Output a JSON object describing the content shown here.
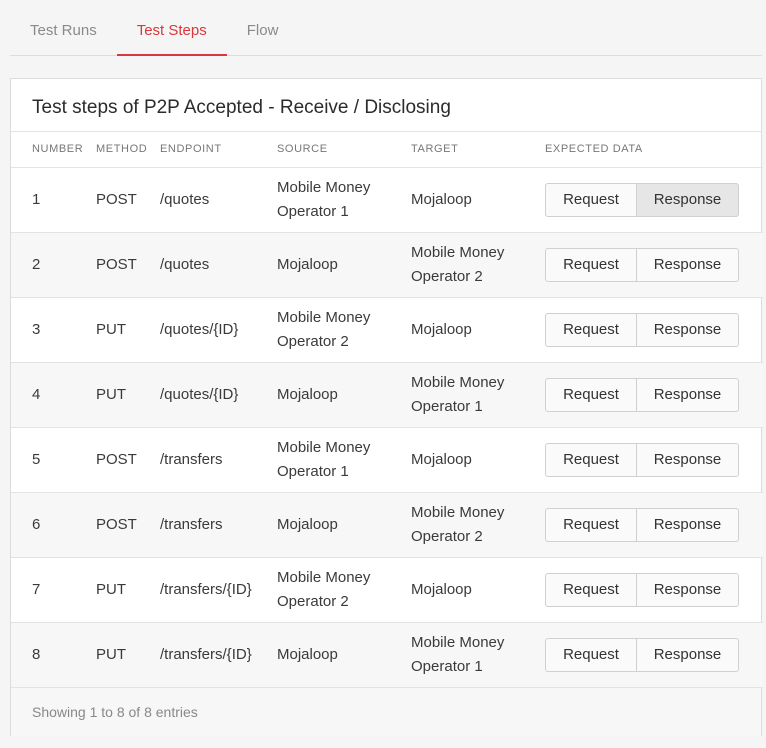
{
  "tabs": [
    {
      "label": "Test Runs",
      "active": false
    },
    {
      "label": "Test Steps",
      "active": true
    },
    {
      "label": "Flow",
      "active": false
    }
  ],
  "card": {
    "title": "Test steps of P2P Accepted - Receive / Disclosing"
  },
  "table": {
    "headers": [
      "NUMBER",
      "METHOD",
      "ENDPOINT",
      "SOURCE",
      "TARGET",
      "EXPECTED DATA"
    ],
    "request_label": "Request",
    "response_label": "Response",
    "rows": [
      {
        "number": "1",
        "method": "POST",
        "endpoint": "/quotes",
        "source": "Mobile Money Operator 1",
        "target": "Mojaloop"
      },
      {
        "number": "2",
        "method": "POST",
        "endpoint": "/quotes",
        "source": "Mojaloop",
        "target": "Mobile Money Operator 2"
      },
      {
        "number": "3",
        "method": "PUT",
        "endpoint": "/quotes/{ID}",
        "source": "Mobile Money Operator 2",
        "target": "Mojaloop"
      },
      {
        "number": "4",
        "method": "PUT",
        "endpoint": "/quotes/{ID}",
        "source": "Mojaloop",
        "target": "Mobile Money Operator 1"
      },
      {
        "number": "5",
        "method": "POST",
        "endpoint": "/transfers",
        "source": "Mobile Money Operator 1",
        "target": "Mojaloop"
      },
      {
        "number": "6",
        "method": "POST",
        "endpoint": "/transfers",
        "source": "Mojaloop",
        "target": "Mobile Money Operator 2"
      },
      {
        "number": "7",
        "method": "PUT",
        "endpoint": "/transfers/{ID}",
        "source": "Mobile Money Operator 2",
        "target": "Mojaloop"
      },
      {
        "number": "8",
        "method": "PUT",
        "endpoint": "/transfers/{ID}",
        "source": "Mojaloop",
        "target": "Mobile Money Operator 1"
      }
    ]
  },
  "footer": {
    "info": "Showing 1 to 8 of 8 entries"
  },
  "colors": {
    "accent": "#d8383d",
    "border": "#dcdcdc",
    "stripe": "#f7f7f7"
  }
}
